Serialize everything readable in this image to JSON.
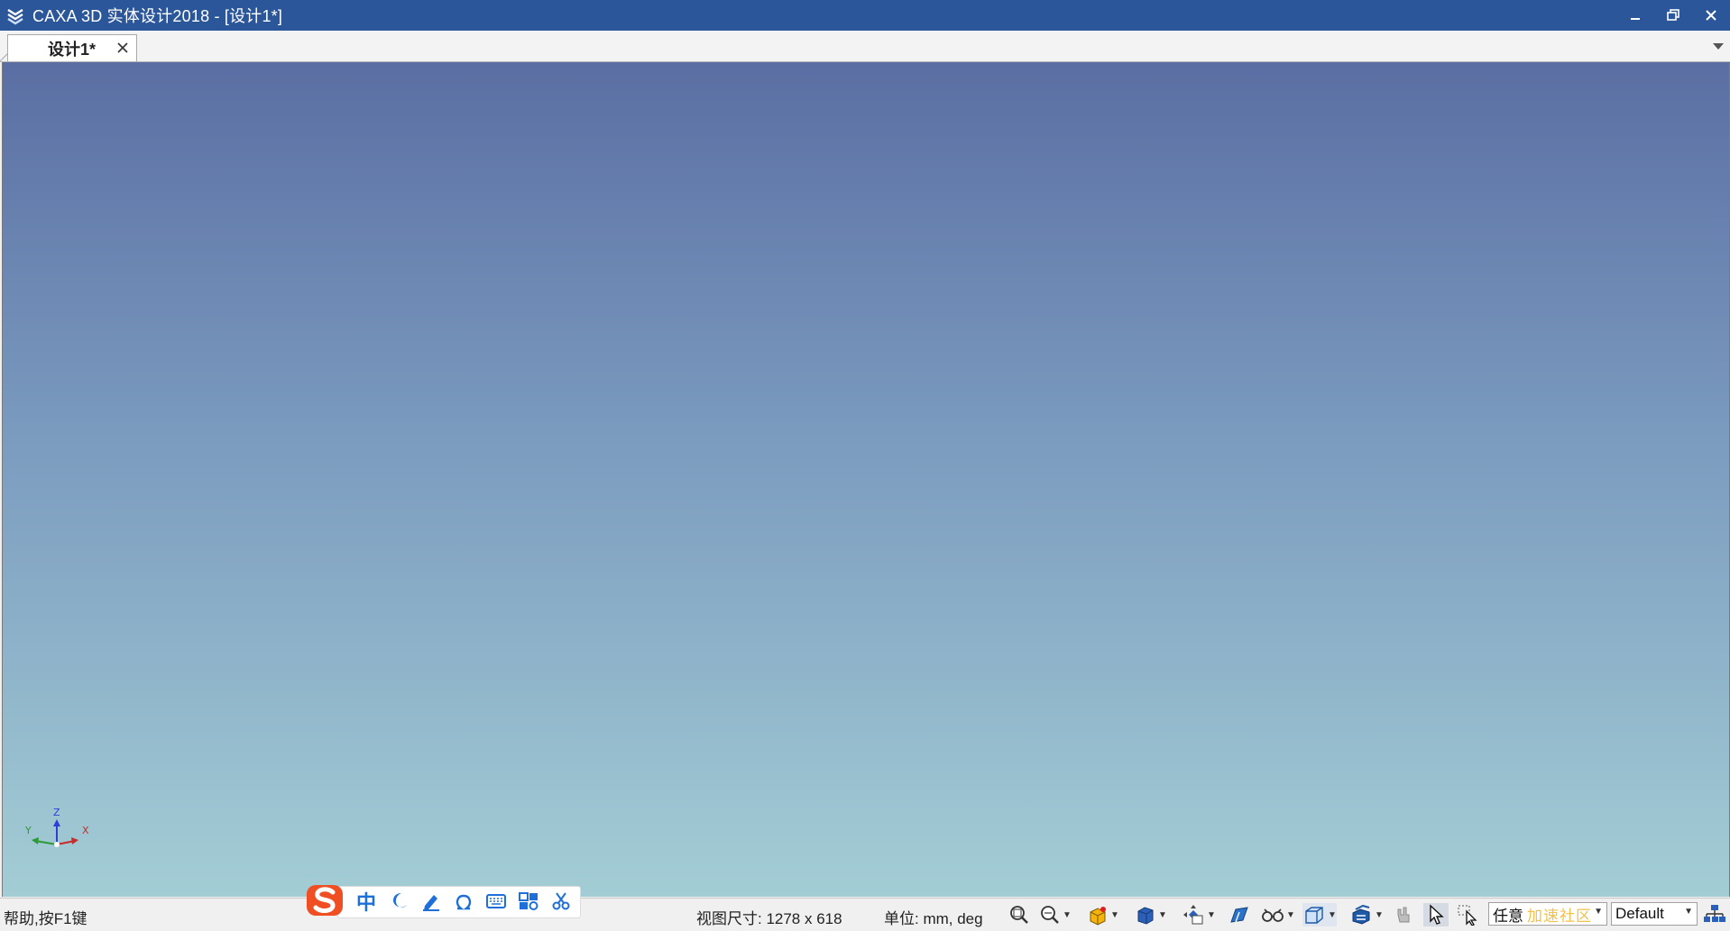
{
  "window": {
    "title": "CAXA 3D 实体设计2018 - [设计1*]"
  },
  "tabs": [
    {
      "label": "设计1*",
      "active": true
    }
  ],
  "status": {
    "help_text": "帮助,按F1键",
    "view_size": "视图尺寸: 1278 x  618",
    "units": "单位: mm, deg",
    "selection_mode": "任意",
    "selection_watermark": "加速社区",
    "style": "Default"
  },
  "ime": {
    "mode_label": "中"
  },
  "triad": {
    "x_label": "X",
    "y_label": "Y",
    "z_label": "Z"
  },
  "colors": {
    "titlebar": "#2b579a",
    "viewport_top": "#5a6ea3",
    "viewport_bottom": "#a3cdd5",
    "ime_accent": "#1e6fd9",
    "ime_logo": "#f04f24"
  }
}
